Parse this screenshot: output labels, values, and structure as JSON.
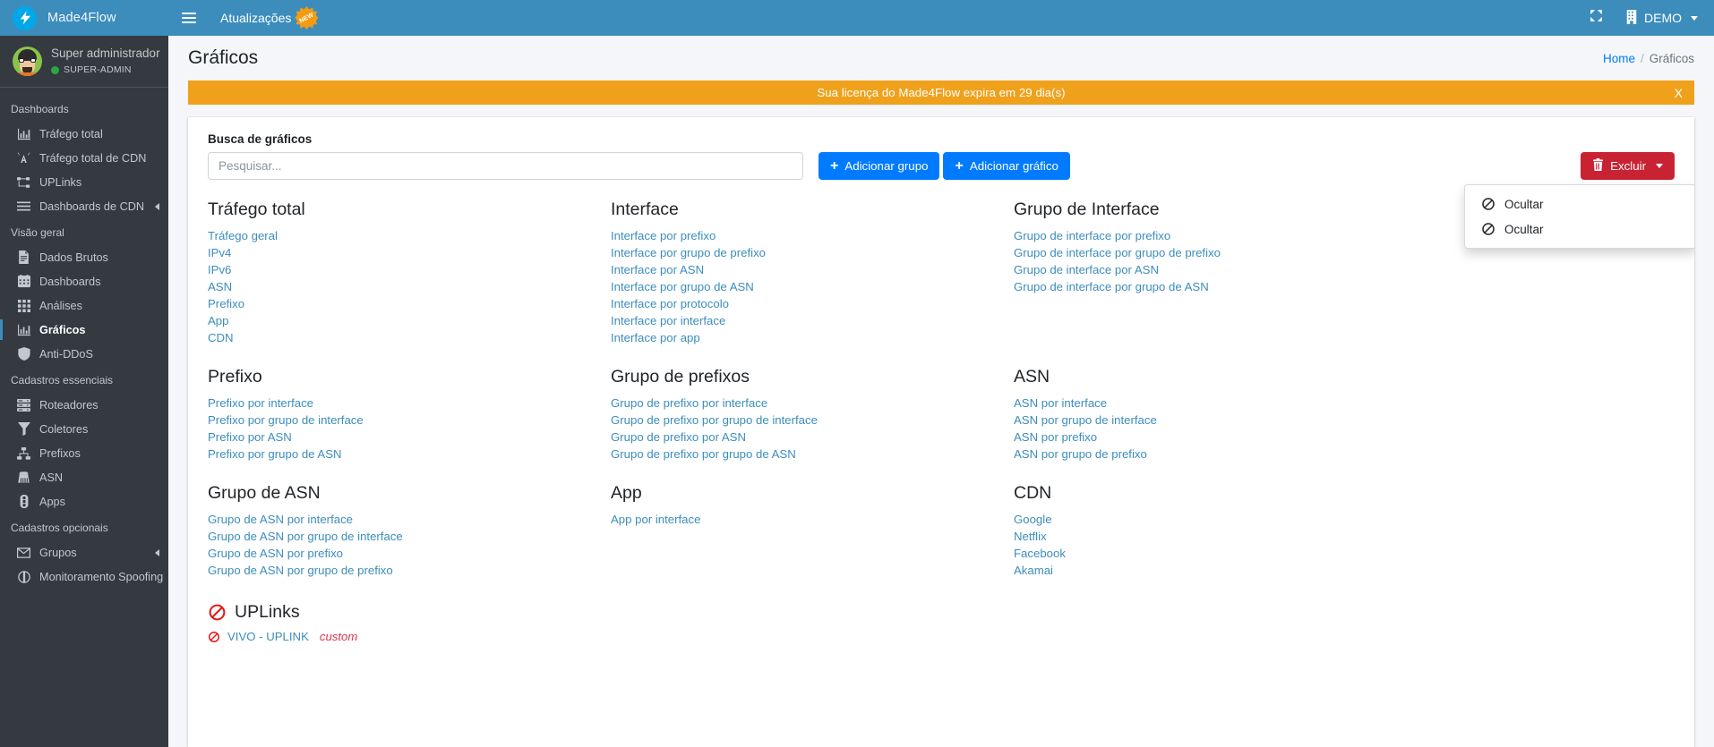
{
  "navbar": {
    "brand": "Made4Flow",
    "menu_toggle_icon": "hamburger-icon",
    "updates_label": "Atualizações",
    "new_badge": "NEW",
    "fullscreen_icon": "expand-arrows-icon",
    "company_label": "DEMO",
    "company_icon": "building-icon"
  },
  "sidebar": {
    "user": {
      "name": "Super administrador",
      "role": "SUPER-ADMIN"
    },
    "sections": [
      {
        "header": "Dashboards",
        "items": [
          {
            "label": "Tráfego total",
            "icon": "bar-chart-icon",
            "active": false,
            "arrow": false
          },
          {
            "label": "Tráfego total de CDN",
            "icon": "broadcast-icon",
            "active": false,
            "arrow": false
          },
          {
            "label": "UPLinks",
            "icon": "sitemap-icon",
            "active": false,
            "arrow": false
          },
          {
            "label": "Dashboards de CDN",
            "icon": "bars-icon",
            "active": false,
            "arrow": true
          }
        ]
      },
      {
        "header": "Visão geral",
        "items": [
          {
            "label": "Dados Brutos",
            "icon": "file-text-icon",
            "active": false,
            "arrow": false
          },
          {
            "label": "Dashboards",
            "icon": "calendar-icon",
            "active": false,
            "arrow": false
          },
          {
            "label": "Análises",
            "icon": "grid-icon",
            "active": false,
            "arrow": false
          },
          {
            "label": "Gráficos",
            "icon": "bar-chart-icon",
            "active": true,
            "arrow": false
          },
          {
            "label": "Anti-DDoS",
            "icon": "shield-icon",
            "active": false,
            "arrow": false
          }
        ]
      },
      {
        "header": "Cadastros essenciais",
        "items": [
          {
            "label": "Roteadores",
            "icon": "server-icon",
            "active": false,
            "arrow": false
          },
          {
            "label": "Coletores",
            "icon": "filter-icon",
            "active": false,
            "arrow": false
          },
          {
            "label": "Prefixos",
            "icon": "network-icon",
            "active": false,
            "arrow": false
          },
          {
            "label": "ASN",
            "icon": "ethernet-port-icon",
            "active": false,
            "arrow": false
          },
          {
            "label": "Apps",
            "icon": "traffic-light-icon",
            "active": false,
            "arrow": false
          }
        ]
      },
      {
        "header": "Cadastros opcionais",
        "items": [
          {
            "label": "Grupos",
            "icon": "envelope-icon",
            "active": false,
            "arrow": true
          },
          {
            "label": "Monitoramento Spoofing",
            "icon": "spoofing-icon",
            "active": false,
            "arrow": false
          }
        ]
      }
    ]
  },
  "page": {
    "title": "Gráficos",
    "breadcrumb": {
      "home": "Home",
      "separator": "/",
      "current": "Gráficos"
    },
    "license_notice": "Sua licença do Made4Flow expira em 29 dia(s)",
    "license_close": "X"
  },
  "toolbar": {
    "search_label": "Busca de gráficos",
    "search_placeholder": "Pesquisar...",
    "search_value": "",
    "add_group_label": "Adicionar grupo",
    "add_chart_label": "Adicionar gráfico",
    "delete_label": "Excluir",
    "dropdown_items": [
      {
        "label": "Ocultar",
        "icon": "ban-icon"
      },
      {
        "label": "Ocultar",
        "icon": "ban-icon"
      }
    ]
  },
  "groups": [
    {
      "title": "Tráfego total",
      "links": [
        "Tráfego geral",
        "IPv4",
        "IPv6",
        "ASN",
        "Prefixo",
        "App",
        "CDN"
      ]
    },
    {
      "title": "Interface",
      "links": [
        "Interface por prefixo",
        "Interface por grupo de prefixo",
        "Interface por ASN",
        "Interface por grupo de ASN",
        "Interface por protocolo",
        "Interface por interface",
        "Interface por app"
      ]
    },
    {
      "title": "Grupo de Interface",
      "links": [
        "Grupo de interface por prefixo",
        "Grupo de interface por grupo de prefixo",
        "Grupo de interface por ASN",
        "Grupo de interface por grupo de ASN"
      ]
    },
    {
      "title": "Prefixo",
      "links": [
        "Prefixo por interface",
        "Prefixo por grupo de interface",
        "Prefixo por ASN",
        "Prefixo por grupo de ASN"
      ]
    },
    {
      "title": "Grupo de prefixos",
      "links": [
        "Grupo de prefixo por interface",
        "Grupo de prefixo por grupo de interface",
        "Grupo de prefixo por ASN",
        "Grupo de prefixo por grupo de ASN"
      ]
    },
    {
      "title": "ASN",
      "links": [
        "ASN por interface",
        "ASN por grupo de interface",
        "ASN por prefixo",
        "ASN por grupo de prefixo"
      ]
    },
    {
      "title": "Grupo de ASN",
      "links": [
        "Grupo de ASN por interface",
        "Grupo de ASN por grupo de interface",
        "Grupo de ASN por prefixo",
        "Grupo de ASN por grupo de prefixo"
      ]
    },
    {
      "title": "App",
      "links": [
        "App por interface"
      ]
    },
    {
      "title": "CDN",
      "links": [
        "Google",
        "Netflix",
        "Facebook",
        "Akamai"
      ]
    }
  ],
  "uplinks": {
    "title": "UPLinks",
    "icon": "ban-icon",
    "items": [
      {
        "label": "VIVO - UPLINK",
        "suffix": "custom",
        "icon": "ban-icon"
      }
    ]
  },
  "colors": {
    "navbar": "#3c8dbc",
    "sidebar": "#343a40",
    "link": "#3c8dbc",
    "primary": "#007bff",
    "danger": "#c82333",
    "warning": "#f0a11b",
    "online": "#28a745"
  }
}
